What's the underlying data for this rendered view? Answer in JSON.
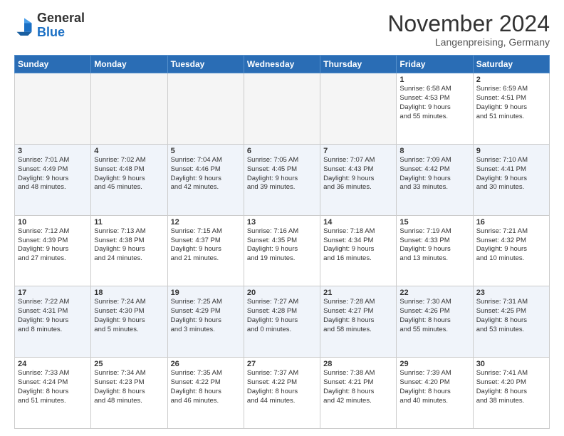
{
  "header": {
    "logo_general": "General",
    "logo_blue": "Blue",
    "month_title": "November 2024",
    "location": "Langenpreising, Germany"
  },
  "columns": [
    "Sunday",
    "Monday",
    "Tuesday",
    "Wednesday",
    "Thursday",
    "Friday",
    "Saturday"
  ],
  "weeks": [
    {
      "days": [
        {
          "num": "",
          "info": ""
        },
        {
          "num": "",
          "info": ""
        },
        {
          "num": "",
          "info": ""
        },
        {
          "num": "",
          "info": ""
        },
        {
          "num": "",
          "info": ""
        },
        {
          "num": "1",
          "info": "Sunrise: 6:58 AM\nSunset: 4:53 PM\nDaylight: 9 hours\nand 55 minutes."
        },
        {
          "num": "2",
          "info": "Sunrise: 6:59 AM\nSunset: 4:51 PM\nDaylight: 9 hours\nand 51 minutes."
        }
      ]
    },
    {
      "days": [
        {
          "num": "3",
          "info": "Sunrise: 7:01 AM\nSunset: 4:49 PM\nDaylight: 9 hours\nand 48 minutes."
        },
        {
          "num": "4",
          "info": "Sunrise: 7:02 AM\nSunset: 4:48 PM\nDaylight: 9 hours\nand 45 minutes."
        },
        {
          "num": "5",
          "info": "Sunrise: 7:04 AM\nSunset: 4:46 PM\nDaylight: 9 hours\nand 42 minutes."
        },
        {
          "num": "6",
          "info": "Sunrise: 7:05 AM\nSunset: 4:45 PM\nDaylight: 9 hours\nand 39 minutes."
        },
        {
          "num": "7",
          "info": "Sunrise: 7:07 AM\nSunset: 4:43 PM\nDaylight: 9 hours\nand 36 minutes."
        },
        {
          "num": "8",
          "info": "Sunrise: 7:09 AM\nSunset: 4:42 PM\nDaylight: 9 hours\nand 33 minutes."
        },
        {
          "num": "9",
          "info": "Sunrise: 7:10 AM\nSunset: 4:41 PM\nDaylight: 9 hours\nand 30 minutes."
        }
      ]
    },
    {
      "days": [
        {
          "num": "10",
          "info": "Sunrise: 7:12 AM\nSunset: 4:39 PM\nDaylight: 9 hours\nand 27 minutes."
        },
        {
          "num": "11",
          "info": "Sunrise: 7:13 AM\nSunset: 4:38 PM\nDaylight: 9 hours\nand 24 minutes."
        },
        {
          "num": "12",
          "info": "Sunrise: 7:15 AM\nSunset: 4:37 PM\nDaylight: 9 hours\nand 21 minutes."
        },
        {
          "num": "13",
          "info": "Sunrise: 7:16 AM\nSunset: 4:35 PM\nDaylight: 9 hours\nand 19 minutes."
        },
        {
          "num": "14",
          "info": "Sunrise: 7:18 AM\nSunset: 4:34 PM\nDaylight: 9 hours\nand 16 minutes."
        },
        {
          "num": "15",
          "info": "Sunrise: 7:19 AM\nSunset: 4:33 PM\nDaylight: 9 hours\nand 13 minutes."
        },
        {
          "num": "16",
          "info": "Sunrise: 7:21 AM\nSunset: 4:32 PM\nDaylight: 9 hours\nand 10 minutes."
        }
      ]
    },
    {
      "days": [
        {
          "num": "17",
          "info": "Sunrise: 7:22 AM\nSunset: 4:31 PM\nDaylight: 9 hours\nand 8 minutes."
        },
        {
          "num": "18",
          "info": "Sunrise: 7:24 AM\nSunset: 4:30 PM\nDaylight: 9 hours\nand 5 minutes."
        },
        {
          "num": "19",
          "info": "Sunrise: 7:25 AM\nSunset: 4:29 PM\nDaylight: 9 hours\nand 3 minutes."
        },
        {
          "num": "20",
          "info": "Sunrise: 7:27 AM\nSunset: 4:28 PM\nDaylight: 9 hours\nand 0 minutes."
        },
        {
          "num": "21",
          "info": "Sunrise: 7:28 AM\nSunset: 4:27 PM\nDaylight: 8 hours\nand 58 minutes."
        },
        {
          "num": "22",
          "info": "Sunrise: 7:30 AM\nSunset: 4:26 PM\nDaylight: 8 hours\nand 55 minutes."
        },
        {
          "num": "23",
          "info": "Sunrise: 7:31 AM\nSunset: 4:25 PM\nDaylight: 8 hours\nand 53 minutes."
        }
      ]
    },
    {
      "days": [
        {
          "num": "24",
          "info": "Sunrise: 7:33 AM\nSunset: 4:24 PM\nDaylight: 8 hours\nand 51 minutes."
        },
        {
          "num": "25",
          "info": "Sunrise: 7:34 AM\nSunset: 4:23 PM\nDaylight: 8 hours\nand 48 minutes."
        },
        {
          "num": "26",
          "info": "Sunrise: 7:35 AM\nSunset: 4:22 PM\nDaylight: 8 hours\nand 46 minutes."
        },
        {
          "num": "27",
          "info": "Sunrise: 7:37 AM\nSunset: 4:22 PM\nDaylight: 8 hours\nand 44 minutes."
        },
        {
          "num": "28",
          "info": "Sunrise: 7:38 AM\nSunset: 4:21 PM\nDaylight: 8 hours\nand 42 minutes."
        },
        {
          "num": "29",
          "info": "Sunrise: 7:39 AM\nSunset: 4:20 PM\nDaylight: 8 hours\nand 40 minutes."
        },
        {
          "num": "30",
          "info": "Sunrise: 7:41 AM\nSunset: 4:20 PM\nDaylight: 8 hours\nand 38 minutes."
        }
      ]
    }
  ]
}
